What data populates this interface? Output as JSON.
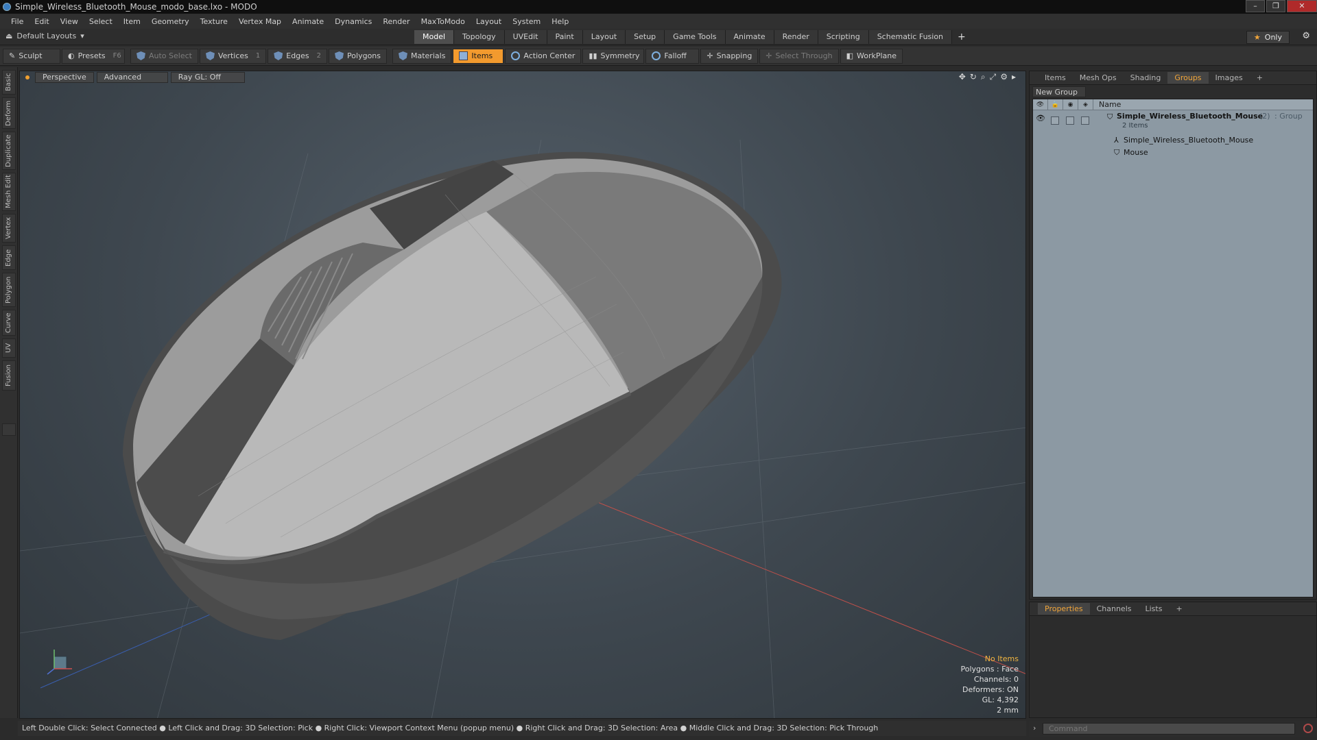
{
  "window": {
    "title": "Simple_Wireless_Bluetooth_Mouse_modo_base.lxo - MODO"
  },
  "menu": [
    "File",
    "Edit",
    "View",
    "Select",
    "Item",
    "Geometry",
    "Texture",
    "Vertex Map",
    "Animate",
    "Dynamics",
    "Render",
    "MaxToModo",
    "Layout",
    "System",
    "Help"
  ],
  "layoutbar": {
    "layouts_label": "Default Layouts",
    "tabs": [
      "Model",
      "Topology",
      "UVEdit",
      "Paint",
      "Layout",
      "Setup",
      "Game Tools",
      "Animate",
      "Render",
      "Scripting",
      "Schematic Fusion"
    ],
    "active_tab": "Model",
    "plus": "+",
    "only_label": "Only"
  },
  "toolbar": {
    "sculpt": "Sculpt",
    "presets": "Presets",
    "presets_key": "F6",
    "auto_select": "Auto Select",
    "vertices": "Vertices",
    "vertices_count": "1",
    "edges": "Edges",
    "edges_count": "2",
    "polygons": "Polygons",
    "materials": "Materials",
    "items": "Items",
    "action_center": "Action Center",
    "symmetry": "Symmetry",
    "falloff": "Falloff",
    "snapping": "Snapping",
    "select_through": "Select Through",
    "workplane": "WorkPlane"
  },
  "left_tabs": [
    "Basic",
    "Deform",
    "Duplicate",
    "Mesh Edit",
    "Vertex",
    "Edge",
    "Polygon",
    "Curve",
    "UV",
    "Fusion"
  ],
  "viewport": {
    "perspective": "Perspective",
    "advanced": "Advanced",
    "raygl": "Ray GL: Off",
    "stats": {
      "items": "No Items",
      "polygons": "Polygons : Face",
      "channels": "Channels: 0",
      "deformers": "Deformers: ON",
      "gl": "GL: 4,392",
      "unit": "2 mm"
    }
  },
  "statusbar": "Left Double Click: Select Connected ● Left Click and Drag: 3D Selection: Pick ● Right Click: Viewport Context Menu (popup menu) ● Right Click and Drag: 3D Selection: Area ● Middle Click and Drag: 3D Selection: Pick Through",
  "right_panel": {
    "tabs": [
      "Items",
      "Mesh Ops",
      "Shading",
      "Groups",
      "Images"
    ],
    "active_tab": "Groups",
    "plus": "+",
    "new_group": "New Group",
    "column_name": "Name",
    "group_name": "Simple_Wireless_Bluetooth_Mouse",
    "group_count": "(2)",
    "group_type": ": Group",
    "group_items": "2 Items",
    "children": [
      "Simple_Wireless_Bluetooth_Mouse",
      "Mouse"
    ]
  },
  "properties_panel": {
    "tabs": [
      "Properties",
      "Channels",
      "Lists"
    ],
    "active_tab": "Properties",
    "plus": "+"
  },
  "command": {
    "placeholder": "Command"
  },
  "colors": {
    "accent": "#f29a2e",
    "viewport_bg": "#3e474f",
    "list_bg": "#8c99a3"
  }
}
